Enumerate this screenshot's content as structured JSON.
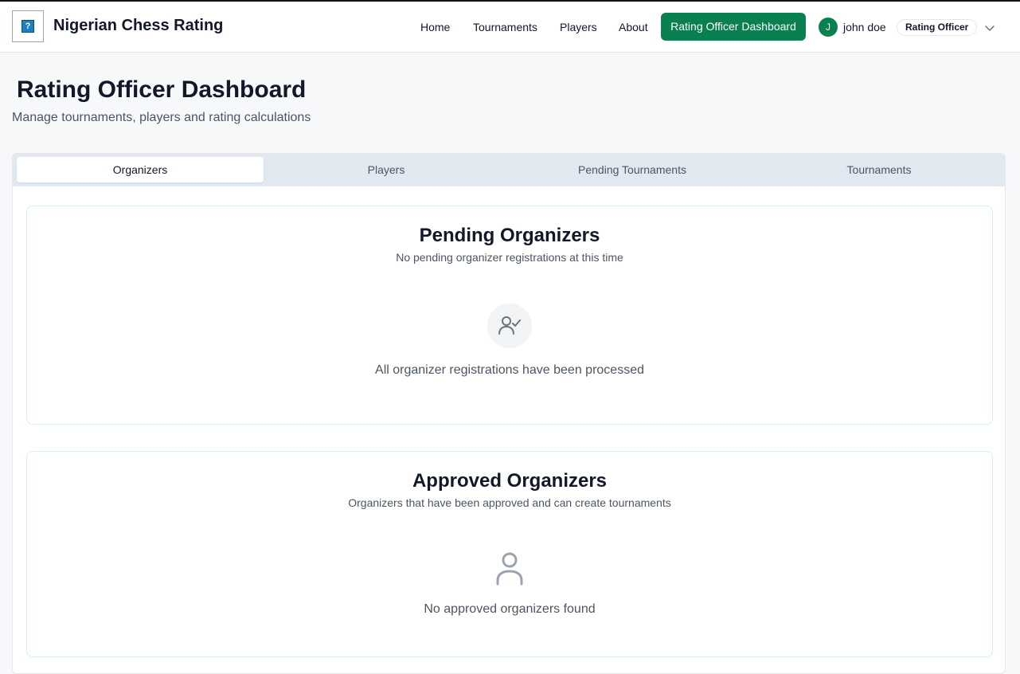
{
  "brand": {
    "name": "Nigerian Chess Rating"
  },
  "nav": {
    "home": "Home",
    "tournaments": "Tournaments",
    "players": "Players",
    "about": "About",
    "dashboard": "Rating Officer Dashboard"
  },
  "user": {
    "initial": "J",
    "name": "john doe",
    "role": "Rating Officer"
  },
  "page": {
    "title": "Rating Officer Dashboard",
    "subtitle": "Manage tournaments, players and rating calculations"
  },
  "tabs": [
    {
      "label": "Organizers",
      "active": true
    },
    {
      "label": "Players",
      "active": false
    },
    {
      "label": "Pending Tournaments",
      "active": false
    },
    {
      "label": "Tournaments",
      "active": false
    }
  ],
  "pending": {
    "title": "Pending Organizers",
    "description": "No pending organizer registrations at this time",
    "empty_message": "All organizer registrations have been processed",
    "icon": "user-check-icon"
  },
  "approved": {
    "title": "Approved Organizers",
    "description": "Organizers that have been approved and can create tournaments",
    "empty_message": "No approved organizers found",
    "icon": "user-icon"
  },
  "colors": {
    "accent": "#0a7f4f",
    "tab_bar": "#e2e8f0",
    "page_bg": "#f6f8fa"
  }
}
